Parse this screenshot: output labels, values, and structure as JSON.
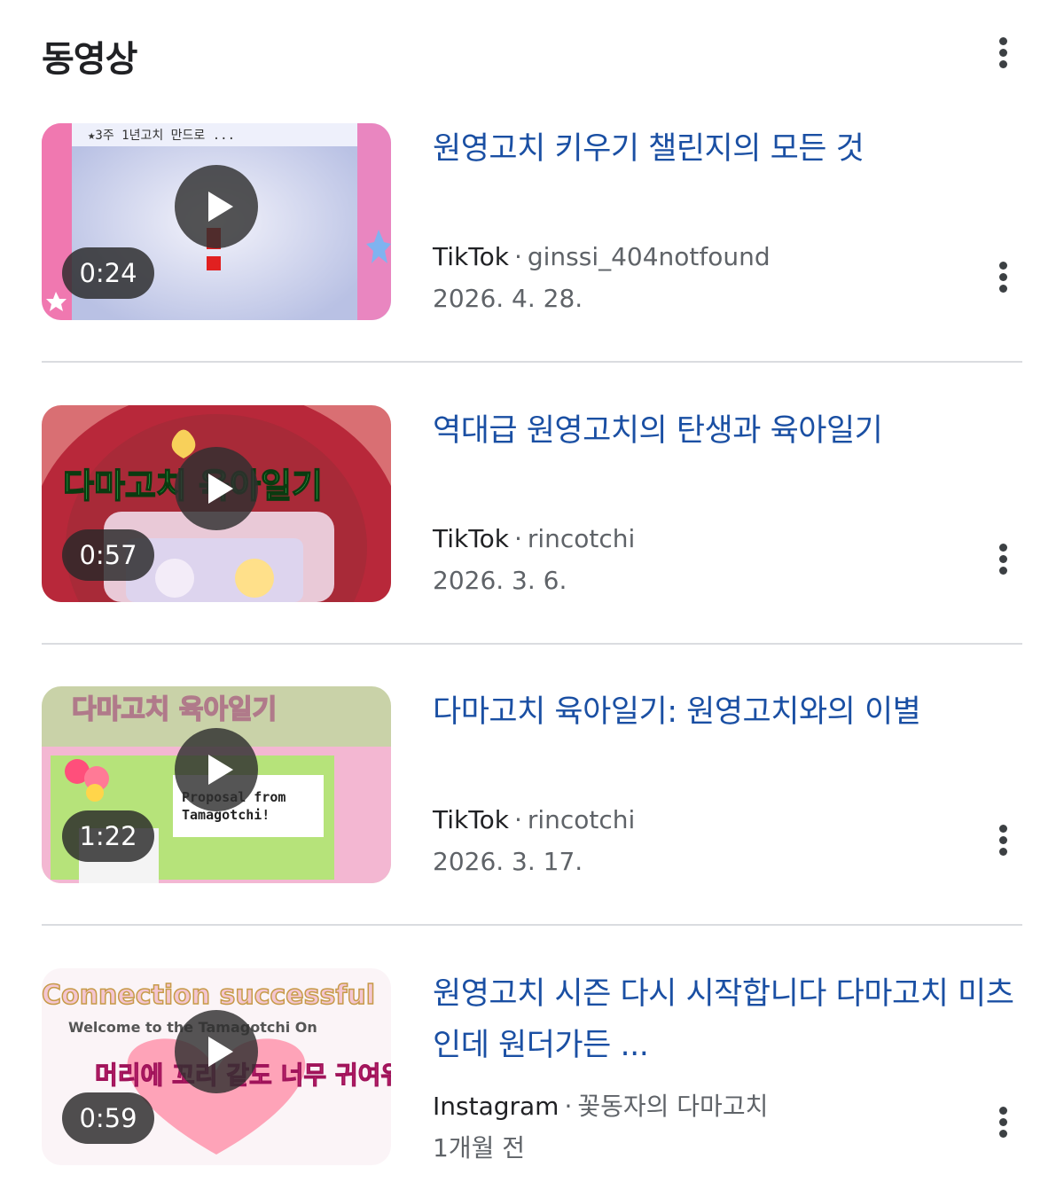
{
  "header": {
    "title": "동영상"
  },
  "videos": [
    {
      "title": "원영고치 키우기 챌린지의 모든 것",
      "source": "TikTok",
      "author": "ginssi_404notfound",
      "date": "2026. 4. 28.",
      "duration": "0:24"
    },
    {
      "title": "역대급 원영고치의 탄생과 육아일기",
      "source": "TikTok",
      "author": "rincotchi",
      "date": "2026. 3. 6.",
      "duration": "0:57"
    },
    {
      "title": "다마고치 육아일기: 원영고치와의 이별",
      "source": "TikTok",
      "author": "rincotchi",
      "date": "2026. 3. 17.",
      "duration": "1:22"
    },
    {
      "title": "원영고치 시즌 다시 시작합니다 다마고치 미츠인데 원더가든 ...",
      "source": "Instagram",
      "author": "꽃동자의 다마고치",
      "date": "1개월 전",
      "duration": "0:59"
    }
  ],
  "thumbnail_text": {
    "v1": "★3주 1년고치 만드로 ...",
    "v2": "다마고치 육아일기",
    "v3": "다마고치 육아일기",
    "v3b": "Proposal from",
    "v3c": "Tamagotchi!",
    "v4": "Connection successful",
    "v4b": "Welcome to the Tamagotchi On",
    "v4c": "머리에 꼬리 같도 너무 귀여워"
  },
  "icons": {
    "more": "more-vert-icon",
    "play": "play-icon"
  }
}
